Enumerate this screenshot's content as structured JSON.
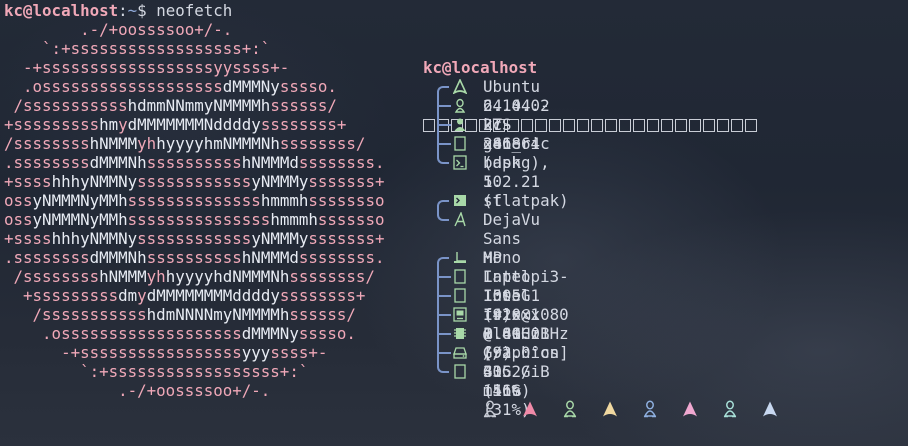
{
  "prompt": {
    "user_host": "kc@localhost",
    "separator": ":",
    "path": "~",
    "symbol": "$",
    "command": "neofetch"
  },
  "logo_lines": [
    [
      [
        "p",
        "        .-/+oossssoo+/-."
      ]
    ],
    [
      [
        "p",
        "    `:+ssssssssssssssssss+:`"
      ]
    ],
    [
      [
        "p",
        "  -+ssssssssssssssssssyyssss+-"
      ]
    ],
    [
      [
        "p",
        "  .osssssssssssssssssss"
      ],
      [
        "w",
        "dMMMNy"
      ],
      [
        "p",
        "sssso."
      ]
    ],
    [
      [
        "p",
        " /sssssssssss"
      ],
      [
        "w",
        "hdmmNNmmyNMMMMh"
      ],
      [
        "p",
        "ssssss/"
      ]
    ],
    [
      [
        "p",
        "+sssssssss"
      ],
      [
        "w",
        "hm"
      ],
      [
        "p",
        "y"
      ],
      [
        "w",
        "dMMMMMMMNddddy"
      ],
      [
        "p",
        "ssssssss+"
      ]
    ],
    [
      [
        "p",
        "/ssssssss"
      ],
      [
        "w",
        "hNMMM"
      ],
      [
        "p",
        "yh"
      ],
      [
        "w",
        "hyyyyhmNMMMNh"
      ],
      [
        "p",
        "ssssssss/"
      ]
    ],
    [
      [
        "p",
        ".ssssssss"
      ],
      [
        "w",
        "dMMMNh"
      ],
      [
        "p",
        "ssssssssss"
      ],
      [
        "w",
        "hNMMMd"
      ],
      [
        "p",
        "ssssssss."
      ]
    ],
    [
      [
        "p",
        "+ssss"
      ],
      [
        "w",
        "hhhyNMMNy"
      ],
      [
        "p",
        "ssssssssssss"
      ],
      [
        "w",
        "yNMMMy"
      ],
      [
        "p",
        "sssssss+"
      ]
    ],
    [
      [
        "p",
        "oss"
      ],
      [
        "w",
        "yNMMMNyMMh"
      ],
      [
        "p",
        "ssssssssssssss"
      ],
      [
        "w",
        "hmmmh"
      ],
      [
        "p",
        "ssssssso"
      ]
    ],
    [
      [
        "p",
        "oss"
      ],
      [
        "w",
        "yNMMMNyMMh"
      ],
      [
        "p",
        "sssssssssssssss"
      ],
      [
        "w",
        "hmmmh"
      ],
      [
        "p",
        "sssssso"
      ]
    ],
    [
      [
        "p",
        "+ssss"
      ],
      [
        "w",
        "hhhyNMMNy"
      ],
      [
        "p",
        "ssssssssssss"
      ],
      [
        "w",
        "yNMMMy"
      ],
      [
        "p",
        "sssssss+"
      ]
    ],
    [
      [
        "p",
        ".ssssssss"
      ],
      [
        "w",
        "dMMMNh"
      ],
      [
        "p",
        "ssssssssss"
      ],
      [
        "w",
        "hNMMMd"
      ],
      [
        "p",
        "ssssssss."
      ]
    ],
    [
      [
        "p",
        " /ssssssss"
      ],
      [
        "w",
        "hNMMM"
      ],
      [
        "p",
        "yh"
      ],
      [
        "w",
        "hyyyyhdNMMMNh"
      ],
      [
        "p",
        "ssssssss/"
      ]
    ],
    [
      [
        "p",
        "  +sssssssss"
      ],
      [
        "w",
        "dm"
      ],
      [
        "p",
        "y"
      ],
      [
        "w",
        "dMMMMMMMMddddy"
      ],
      [
        "p",
        "ssssssss+"
      ]
    ],
    [
      [
        "p",
        "   /sssssssssss"
      ],
      [
        "w",
        "hdmNNNNmyNMMMMh"
      ],
      [
        "p",
        "ssssss/"
      ]
    ],
    [
      [
        "p",
        "    .osssssssssssssssssss"
      ],
      [
        "w",
        "dMMMNy"
      ],
      [
        "p",
        "sssso."
      ]
    ],
    [
      [
        "p",
        "      -+sssssssssssssssss"
      ],
      [
        "w",
        "yyy"
      ],
      [
        "p",
        "ssss+-"
      ]
    ],
    [
      [
        "p",
        "        `:+ssssssssssssssssss+:`"
      ]
    ],
    [
      [
        "p",
        "            .-/+oossssoo+/-."
      ]
    ]
  ],
  "info": {
    "title": "kc@localhost",
    "underline_count": 24,
    "groups": [
      {
        "rows": [
          {
            "icon": "arch-logo-icon",
            "value": "Ubuntu 24.04.2 LTS x86_64"
          },
          {
            "icon": "penguin-icon",
            "value": "6.14.0-27-generic"
          },
          {
            "icon": "user-icon",
            "value": "kc"
          },
          {
            "icon": "package-icon",
            "value": "2418 (dpkg), 10 (flatpak)"
          },
          {
            "icon": "terminal-icon",
            "value": "bash 5.2.21"
          }
        ]
      },
      {
        "rows": [
          {
            "icon": "terminal-app-icon",
            "value": "st"
          },
          {
            "icon": "font-icon",
            "value": "DejaVu Sans Mono"
          }
        ]
      },
      {
        "rows": [
          {
            "icon": "laptop-icon",
            "value": "HP Laptop 15s-fr1xxx"
          },
          {
            "icon": "cpu-icon",
            "value": "Intel i3-1005G1 (4) @ 3.4GHz [92.0°on]"
          },
          {
            "icon": "gpu-icon",
            "value": "Intel Iris Plus Graphics G1"
          },
          {
            "icon": "display-icon",
            "value": "1920x1080 @ 60.01Hz"
          },
          {
            "icon": "memory-icon",
            "value": "1.81GiB / 3.52GiB (51%)"
          },
          {
            "icon": "disk-icon",
            "value": "(/)  43G / 146G (31%)"
          },
          {
            "icon": "clock-icon",
            "value": "30 mins"
          }
        ]
      }
    ]
  },
  "palette": [
    {
      "icon": "tux-icon",
      "color": "#c8ccd6"
    },
    {
      "icon": "arch-icon",
      "color": "#f08aa8"
    },
    {
      "icon": "tux-icon",
      "color": "#a8d8a8"
    },
    {
      "icon": "arch-icon",
      "color": "#f0d8a0"
    },
    {
      "icon": "tux-icon",
      "color": "#8fb0e0"
    },
    {
      "icon": "arch-icon",
      "color": "#f0a8d0"
    },
    {
      "icon": "tux-icon",
      "color": "#a8e0d8"
    },
    {
      "icon": "arch-icon",
      "color": "#c8d8f0"
    }
  ],
  "colors": {
    "pink": "#f0a8b8",
    "white": "#e8ecf4",
    "tree": "#7a94c8",
    "icon_green": "#a8d8a8",
    "text": "#d4d8e2"
  }
}
